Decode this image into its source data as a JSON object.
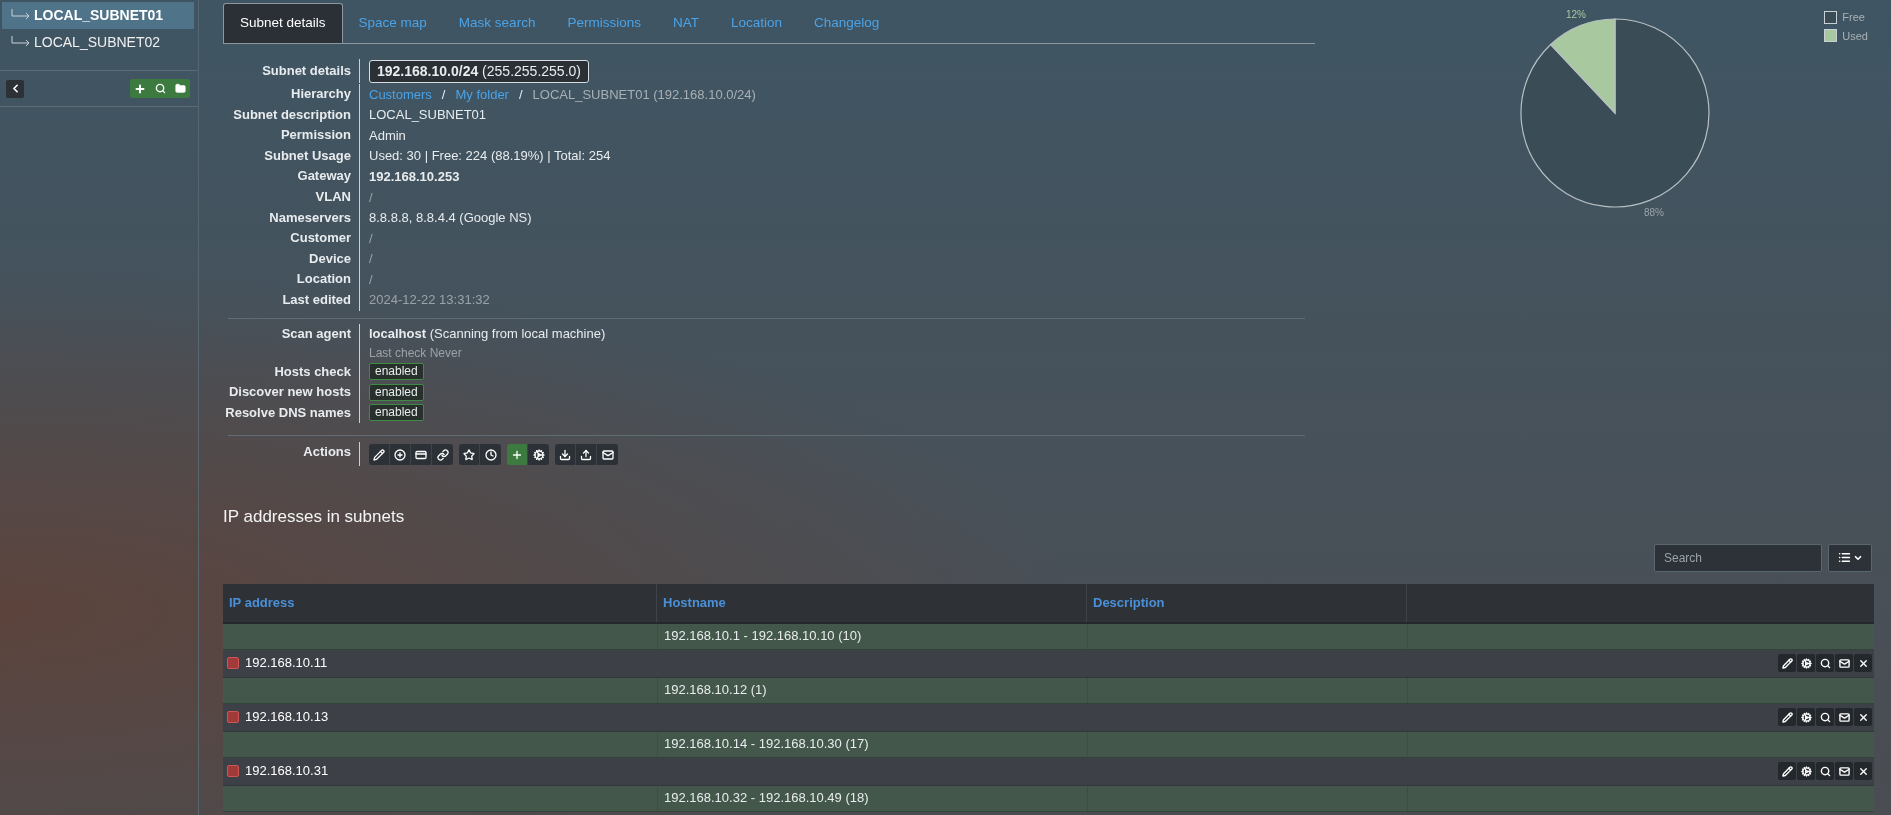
{
  "sidebar": {
    "items": [
      {
        "label": "LOCAL_SUBNET01",
        "selected": true
      },
      {
        "label": "LOCAL_SUBNET02",
        "selected": false
      }
    ]
  },
  "tabs": [
    {
      "label": "Subnet details",
      "selected": true
    },
    {
      "label": "Space map",
      "selected": false
    },
    {
      "label": "Mask search",
      "selected": false
    },
    {
      "label": "Permissions",
      "selected": false
    },
    {
      "label": "NAT",
      "selected": false
    },
    {
      "label": "Location",
      "selected": false
    },
    {
      "label": "Changelog",
      "selected": false
    }
  ],
  "details": [
    {
      "label": "Subnet details",
      "kind": "boxed",
      "value": "**192.168.10.0/24** (255.255.255.0)"
    },
    {
      "label": "Hierarchy",
      "kind": "path",
      "items": [
        {
          "kind": "link",
          "text": "Customers"
        },
        {
          "kind": "sep",
          "text": "/"
        },
        {
          "kind": "link",
          "text": "My folder"
        },
        {
          "kind": "sep",
          "text": "/"
        },
        {
          "kind": "current",
          "text": "LOCAL_SUBNET01 (192.168.10.0/24)"
        }
      ]
    },
    {
      "label": "Subnet description",
      "kind": "text",
      "value": "LOCAL_SUBNET01"
    },
    {
      "label": "Permission",
      "kind": "text",
      "value": "Admin"
    },
    {
      "label": "Subnet Usage",
      "kind": "text",
      "value": "Used: 30 | Free: 224 (88.19%) | Total: 254"
    },
    {
      "label": "Gateway",
      "kind": "bold",
      "value": "192.168.10.253"
    },
    {
      "label": "VLAN",
      "kind": "muted",
      "value": "/"
    },
    {
      "label": "Nameservers",
      "kind": "text",
      "value": "8.8.8.8, 8.8.4.4 (Google NS)"
    },
    {
      "label": "Customer",
      "kind": "muted",
      "value": "/"
    },
    {
      "label": "Device",
      "kind": "muted",
      "value": "/"
    },
    {
      "label": "Location",
      "kind": "muted",
      "value": "/"
    },
    {
      "label": "Last edited",
      "kind": "muted",
      "value": "2024-12-22 13:31:32"
    }
  ],
  "scan": {
    "label": "Scan agent",
    "value": "**localhost** (Scanning from local machine)",
    "note": "Last check Never",
    "checks": [
      {
        "label": "Hosts check",
        "status": "enabled"
      },
      {
        "label": "Discover new hosts",
        "status": "enabled"
      },
      {
        "label": "Resolve DNS names",
        "status": "enabled"
      }
    ]
  },
  "actions": {
    "label": "Actions"
  },
  "usage_chart": {
    "chart_data": {
      "type": "pie",
      "categories": [
        "Free",
        "Used"
      ],
      "values": [
        88,
        12
      ],
      "colors": [
        "#3a4c56",
        "#a8c8a0"
      ],
      "value_labels": [
        "88%",
        "12%"
      ]
    }
  },
  "addresses": {
    "title": "IP addresses in subnets",
    "search": {
      "placeholder": "Search"
    },
    "columns": [
      "IP address",
      "Hostname",
      "Description"
    ],
    "rows": [
      {
        "kind": "range",
        "text": "192.168.10.1 - 192.168.10.10 (10)"
      },
      {
        "kind": "ip",
        "text": "192.168.10.11"
      },
      {
        "kind": "range",
        "text": "192.168.10.12 (1)"
      },
      {
        "kind": "ip",
        "text": "192.168.10.13"
      },
      {
        "kind": "range",
        "text": "192.168.10.14 - 192.168.10.30 (17)"
      },
      {
        "kind": "ip",
        "text": "192.168.10.31"
      },
      {
        "kind": "range",
        "text": "192.168.10.32 - 192.168.10.49 (18)"
      }
    ]
  }
}
